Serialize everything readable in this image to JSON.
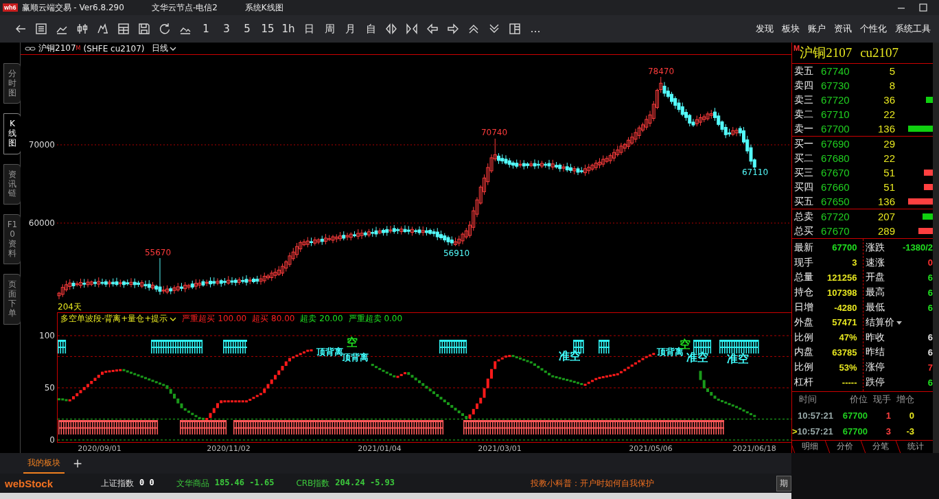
{
  "window": {
    "logo": "wh6",
    "title": "赢顺云端交易 - Ver6.8.290",
    "server": "文华云节点-电信2",
    "view": "系统K线图"
  },
  "toolbar": {
    "periods": [
      "1",
      "3",
      "5",
      "15",
      "1h",
      "日",
      "周",
      "月",
      "自"
    ],
    "more": "…",
    "menu": [
      "发现",
      "板块",
      "账户",
      "资讯",
      "个性化",
      "系统工具"
    ]
  },
  "side_tabs": [
    {
      "label": "分时图",
      "selected": false
    },
    {
      "label": "K线图",
      "selected": true
    },
    {
      "label": "资讯链",
      "selected": false
    },
    {
      "label": "F10资料",
      "selected": false
    },
    {
      "label": "页面下单",
      "selected": false
    }
  ],
  "chart": {
    "contract": "沪铜2107",
    "contract_mark": "M",
    "code": "(SHFE cu2107)",
    "period": "日线",
    "price_ticks": [
      "70000",
      "60000"
    ],
    "price_labels": [
      {
        "text": "78470",
        "kind": "high"
      },
      {
        "text": "70740",
        "kind": "high"
      },
      {
        "text": "55670",
        "kind": "high"
      },
      {
        "text": "56910",
        "kind": "low"
      },
      {
        "text": "67110",
        "kind": "low"
      }
    ],
    "bars_count": "204天",
    "indicator": {
      "name": "多空单波段-背离+量仓+提示",
      "params": [
        {
          "label": "严重超买",
          "value": "100.00",
          "color": "#ff2020"
        },
        {
          "label": "超买",
          "value": "80.00",
          "color": "#ff2020"
        },
        {
          "label": "超卖",
          "value": "20.00",
          "color": "#20e020"
        },
        {
          "label": "严重超卖",
          "value": "0.00",
          "color": "#20e020"
        }
      ],
      "ticks": [
        "100",
        "50",
        "0"
      ],
      "signals": [
        {
          "text": "顶背离",
          "kind": "divergence",
          "color": "#40ffff"
        },
        {
          "text": "空",
          "kind": "signal",
          "color": "#20e020"
        },
        {
          "text": "顶背离",
          "kind": "divergence",
          "color": "#40ffff"
        },
        {
          "text": "准空",
          "kind": "signal",
          "color": "#40ffff"
        },
        {
          "text": "顶背离",
          "kind": "divergence",
          "color": "#40ffff"
        },
        {
          "text": "空",
          "kind": "signal",
          "color": "#20e020"
        },
        {
          "text": "准空",
          "kind": "signal",
          "color": "#40ffff"
        },
        {
          "text": "准空",
          "kind": "signal",
          "color": "#40ffff"
        }
      ]
    },
    "dates": [
      "2020/09/01",
      "2020/11/02",
      "2021/01/04",
      "2021/03/01",
      "2021/05/06",
      "2021/06/18"
    ]
  },
  "quote": {
    "mark": "M",
    "name": "沪铜2107",
    "code": "cu2107",
    "orders": [
      {
        "label": "卖五",
        "price": "67740",
        "volume": "5"
      },
      {
        "label": "卖四",
        "price": "67730",
        "volume": "8"
      },
      {
        "label": "卖三",
        "price": "67720",
        "volume": "36"
      },
      {
        "label": "卖二",
        "price": "67710",
        "volume": "22"
      },
      {
        "label": "卖一",
        "price": "67700",
        "volume": "136"
      },
      {
        "label": "买一",
        "price": "67690",
        "volume": "29"
      },
      {
        "label": "买二",
        "price": "67680",
        "volume": "22"
      },
      {
        "label": "买三",
        "price": "67670",
        "volume": "51"
      },
      {
        "label": "买四",
        "price": "67660",
        "volume": "51"
      },
      {
        "label": "买五",
        "price": "67650",
        "volume": "136"
      }
    ],
    "totals": [
      {
        "label": "总卖",
        "price": "67720",
        "volume": "207"
      },
      {
        "label": "总买",
        "price": "67670",
        "volume": "289"
      }
    ],
    "stats_left": [
      {
        "label": "最新",
        "value": "67700",
        "color": "#20e020"
      },
      {
        "label": "现手",
        "value": "3",
        "color": "#e8e820"
      },
      {
        "label": "总量",
        "value": "121256",
        "color": "#e8e820"
      },
      {
        "label": "持仓",
        "value": "107398",
        "color": "#e8e820"
      },
      {
        "label": "日增",
        "value": "-4280",
        "color": "#e8e820"
      },
      {
        "label": "外盘",
        "value": "57471",
        "color": "#e8e820"
      },
      {
        "label": "比例",
        "value": "47%",
        "color": "#e8e820"
      },
      {
        "label": "内盘",
        "value": "63785",
        "color": "#e8e820"
      },
      {
        "label": "比例",
        "value": "53%",
        "color": "#e8e820"
      },
      {
        "label": "杠杆",
        "value": "-----",
        "color": "#e8e820"
      }
    ],
    "stats_right": [
      {
        "label": "涨跌",
        "value": "-1380/2",
        "color": "#20e020",
        "kind": "value"
      },
      {
        "label": "速涨",
        "value": "0",
        "color": "#ff3030",
        "kind": "value"
      },
      {
        "label": "开盘",
        "value": "6",
        "color": "#20e020",
        "kind": "value"
      },
      {
        "label": "最高",
        "value": "6",
        "color": "#20e020",
        "kind": "value"
      },
      {
        "label": "最低",
        "value": "6",
        "color": "#20e020",
        "kind": "value"
      },
      {
        "label": "结算价",
        "kind": "dropdown"
      },
      {
        "label": "昨收",
        "value": "6",
        "color": "#e0e0e0",
        "kind": "value"
      },
      {
        "label": "昨结",
        "value": "6",
        "color": "#e0e0e0",
        "kind": "value"
      },
      {
        "label": "涨停",
        "value": "7",
        "color": "#ff3030",
        "kind": "value"
      },
      {
        "label": "跌停",
        "value": "6",
        "color": "#20e020",
        "kind": "value"
      }
    ],
    "ticks_columns": [
      "时间",
      "价位",
      "现手",
      "增仓"
    ],
    "ticks": [
      {
        "time": "10:57:21",
        "price": "67700",
        "volume": "1",
        "change": "0"
      },
      {
        "pointer": ">",
        "time": "10:57:21",
        "price": "67700",
        "volume": "3",
        "change": "-3"
      }
    ],
    "tabs": [
      "明细",
      "分价",
      "分笔",
      "统计"
    ]
  },
  "bottom_tabs": [
    {
      "label": "我的板块",
      "selected": true
    }
  ],
  "add_tab": "+",
  "status": {
    "logo": "webStock",
    "indices": [
      {
        "name": "上证指数",
        "value": "0",
        "change": "0",
        "color": "#ffffff"
      },
      {
        "name": "文华商品",
        "value": "185.46",
        "change": "-1.65",
        "color": "#3cc83c"
      },
      {
        "name": "CRB指数",
        "value": "204.24",
        "change": "-5.93",
        "color": "#3cc83c"
      }
    ],
    "notice": "投教小科普：开户时如何自我保护",
    "button": "期"
  }
}
